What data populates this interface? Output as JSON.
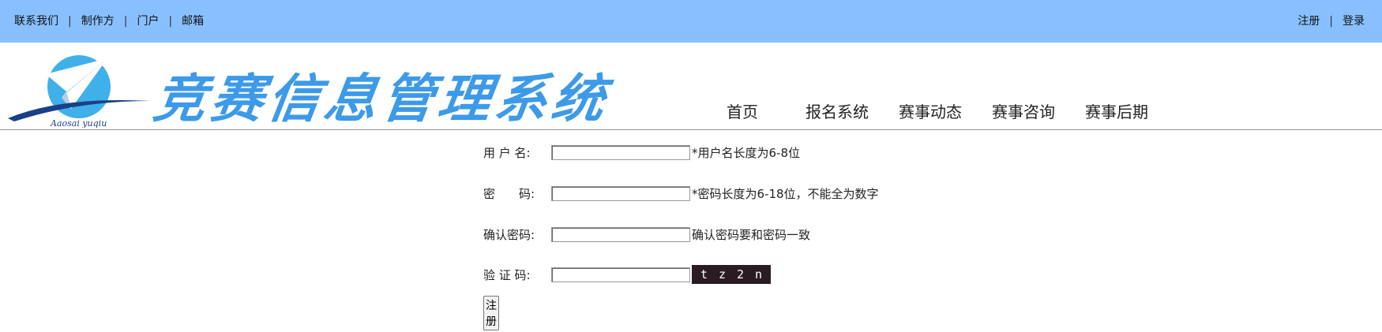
{
  "topbar": {
    "left_links": [
      "联系我们",
      "制作方",
      "门户",
      "邮箱"
    ],
    "right_links": [
      "注册",
      "登录"
    ],
    "separator": "|",
    "bg_color": "#88c0ff"
  },
  "header": {
    "logo_caption": "Aaosai yuqiu",
    "site_title": "竞赛信息管理系统",
    "nav": [
      "首页",
      "报名系统",
      "赛事动态",
      "赛事咨询",
      "赛事后期"
    ]
  },
  "form": {
    "username_label": "用 户 名:",
    "username_hint": "*用户名长度为6-8位",
    "password_label": "密　　码:",
    "password_hint": "*密码长度为6-18位，不能全为数字",
    "confirm_label": "确认密码:",
    "confirm_hint": "确认密码要和密码一致",
    "captcha_label": "验 证 码:",
    "captcha_chars": [
      "t",
      "z",
      "2",
      "n"
    ],
    "submit_label": "注册"
  }
}
